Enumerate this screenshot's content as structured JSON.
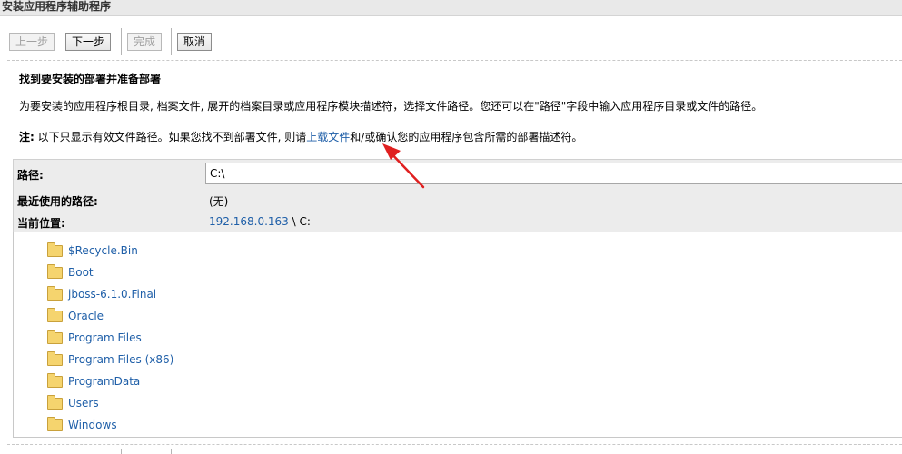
{
  "window": {
    "title": "安装应用程序辅助程序"
  },
  "toolbar": {
    "prev_label": "上一步",
    "next_label": "下一步",
    "finish_label": "完成",
    "cancel_label": "取消"
  },
  "section": {
    "heading": "找到要安装的部署并准备部署",
    "description": "为要安装的应用程序根目录, 档案文件, 展开的档案目录或应用程序模块描述符，选择文件路径。您还可以在\"路径\"字段中输入应用程序目录或文件的路径。",
    "note_label": "注:",
    "note_text_before": " 以下只显示有效文件路径。如果您找不到部署文件, 则请",
    "note_link": "上载文件",
    "note_text_after": "和/或确认您的应用程序包含所需的部署描述符。"
  },
  "fields": {
    "path_label": "路径:",
    "path_value": "C:\\",
    "recent_label": "最近使用的路径:",
    "recent_value": "(无)",
    "location_label": "当前位置:",
    "location_host": "192.168.0.163",
    "location_rest": " \\ C:"
  },
  "files": [
    {
      "name": "$Recycle.Bin"
    },
    {
      "name": "Boot"
    },
    {
      "name": "jboss-6.1.0.Final"
    },
    {
      "name": "Oracle"
    },
    {
      "name": "Program Files"
    },
    {
      "name": "Program Files (x86)"
    },
    {
      "name": "ProgramData"
    },
    {
      "name": "Users"
    },
    {
      "name": "Windows"
    }
  ],
  "icons": {
    "folder": "folder-icon"
  },
  "colors": {
    "link": "#1f5fa8",
    "annotation_arrow": "#e02020",
    "folder": "#f5d46e"
  }
}
